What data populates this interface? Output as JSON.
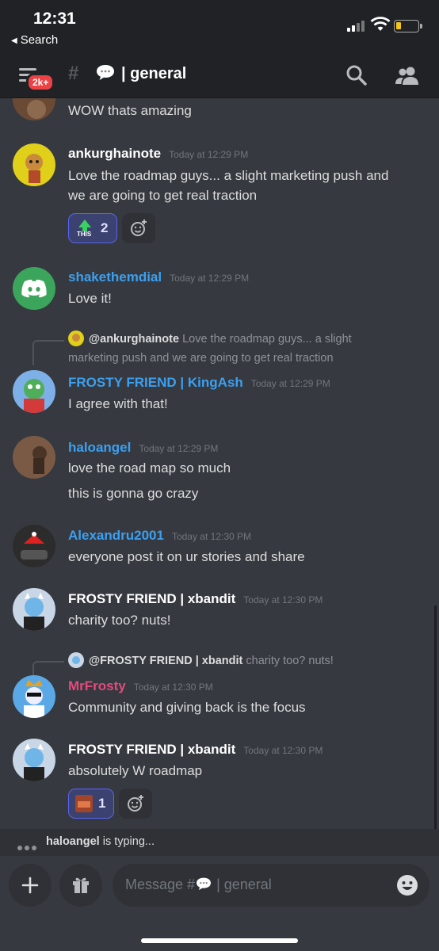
{
  "status_bar": {
    "time": "12:31",
    "back_label": "Search"
  },
  "header": {
    "badge": "2k+",
    "channel_name": "| general"
  },
  "messages": [
    {
      "text": "WOW thats amazing"
    },
    {
      "username": "ankurghainote",
      "timestamp": "Today at 12:29 PM",
      "lines": [
        "Love the roadmap guys... a slight marketing push and",
        "we are going to get real traction"
      ],
      "reaction": {
        "emoji_label": "THIS",
        "count": "2"
      }
    },
    {
      "username": "shakethemdial",
      "timestamp": "Today at 12:29 PM",
      "lines": [
        "Love it!"
      ]
    },
    {
      "reply_to": "@ankurghainote",
      "reply_text": "Love the roadmap guys... a slight marketing push and we are going to get real traction",
      "username": "FROSTY FRIEND | KingAsh",
      "timestamp": "Today at 12:29 PM",
      "lines": [
        "I agree with that!"
      ]
    },
    {
      "username": "haloangel",
      "timestamp": "Today at 12:29 PM",
      "lines": [
        "love the road map so much",
        "this is gonna go crazy"
      ]
    },
    {
      "username": "Alexandru2001",
      "timestamp": "Today at 12:30 PM",
      "lines": [
        "everyone post it on ur stories and share"
      ]
    },
    {
      "username": "FROSTY FRIEND | xbandit",
      "timestamp": "Today at 12:30 PM",
      "lines": [
        "charity too? nuts!"
      ]
    },
    {
      "reply_to": "@FROSTY FRIEND | xbandit",
      "reply_text": "charity too? nuts!",
      "username": "MrFrosty",
      "timestamp": "Today at 12:30 PM",
      "lines": [
        "Community and giving back is the focus"
      ]
    },
    {
      "username": "FROSTY FRIEND | xbandit",
      "timestamp": "Today at 12:30 PM",
      "lines": [
        "absolutely W roadmap"
      ],
      "reaction": {
        "count": "1"
      }
    }
  ],
  "typing": {
    "user": "haloangel",
    "suffix": " is typing..."
  },
  "composer": {
    "placeholder_prefix": "Message #",
    "placeholder_suffix": " | general"
  },
  "colors": {
    "background": "#36393f",
    "header": "#202225",
    "username_white": "#ffffff",
    "username_blue": "#3ba0f2",
    "username_pink": "#e5497e",
    "timestamp": "#72767d",
    "badge": "#ed4245",
    "reaction_border": "#5865f2"
  },
  "icons": [
    "menu-icon",
    "search-icon",
    "members-icon",
    "chat-bubble-icon",
    "add-reaction-icon",
    "plus-icon",
    "gift-icon",
    "emoji-icon"
  ]
}
